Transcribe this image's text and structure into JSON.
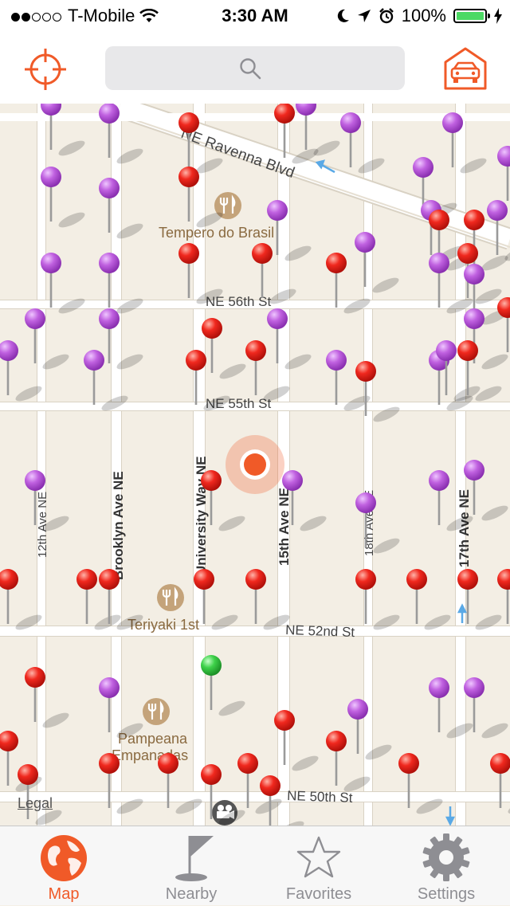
{
  "status_bar": {
    "carrier": "T-Mobile",
    "time": "3:30 AM",
    "battery": "100%",
    "signal_bars_filled": 2,
    "signal_bars_total": 5
  },
  "nav_bar": {
    "left_button_icon": "crosshair-locate-icon",
    "search_icon": "search-icon",
    "search_value": "",
    "right_button_icon": "garage-car-icon",
    "accent_color": "#f05a28"
  },
  "map": {
    "streets": {
      "ravenna": "NE Ravenna Blvd",
      "st56": "NE 56th St",
      "st55": "NE 55th St",
      "st52": "NE 52nd St",
      "st50": "NE 50th St",
      "ave12": "12th Ave NE",
      "brooklyn": "Brooklyn Ave NE",
      "university": "University Way NE",
      "ave15": "15th Ave NE",
      "ave18": "18th Ave NE",
      "ave17": "17th Ave NE"
    },
    "places": {
      "tempero": "Tempero do Brasil",
      "teriyaki": "Teriyaki 1st",
      "pampeana_line1": "Pampeana",
      "pampeana_line2": "Empanadas"
    },
    "legal": "Legal",
    "pin_colors": {
      "red": "#f0281e",
      "purple": "#c061e0",
      "green": "#3ed24a"
    },
    "poi_icons": [
      "restaurant-icon",
      "restaurant-icon",
      "restaurant-icon",
      "movie-camera-icon"
    ]
  },
  "tabs": [
    {
      "label": "Map",
      "icon": "globe-icon",
      "active": true
    },
    {
      "label": "Nearby",
      "icon": "flag-icon",
      "active": false
    },
    {
      "label": "Favorites",
      "icon": "star-icon",
      "active": false
    },
    {
      "label": "Settings",
      "icon": "gear-icon",
      "active": false
    }
  ]
}
